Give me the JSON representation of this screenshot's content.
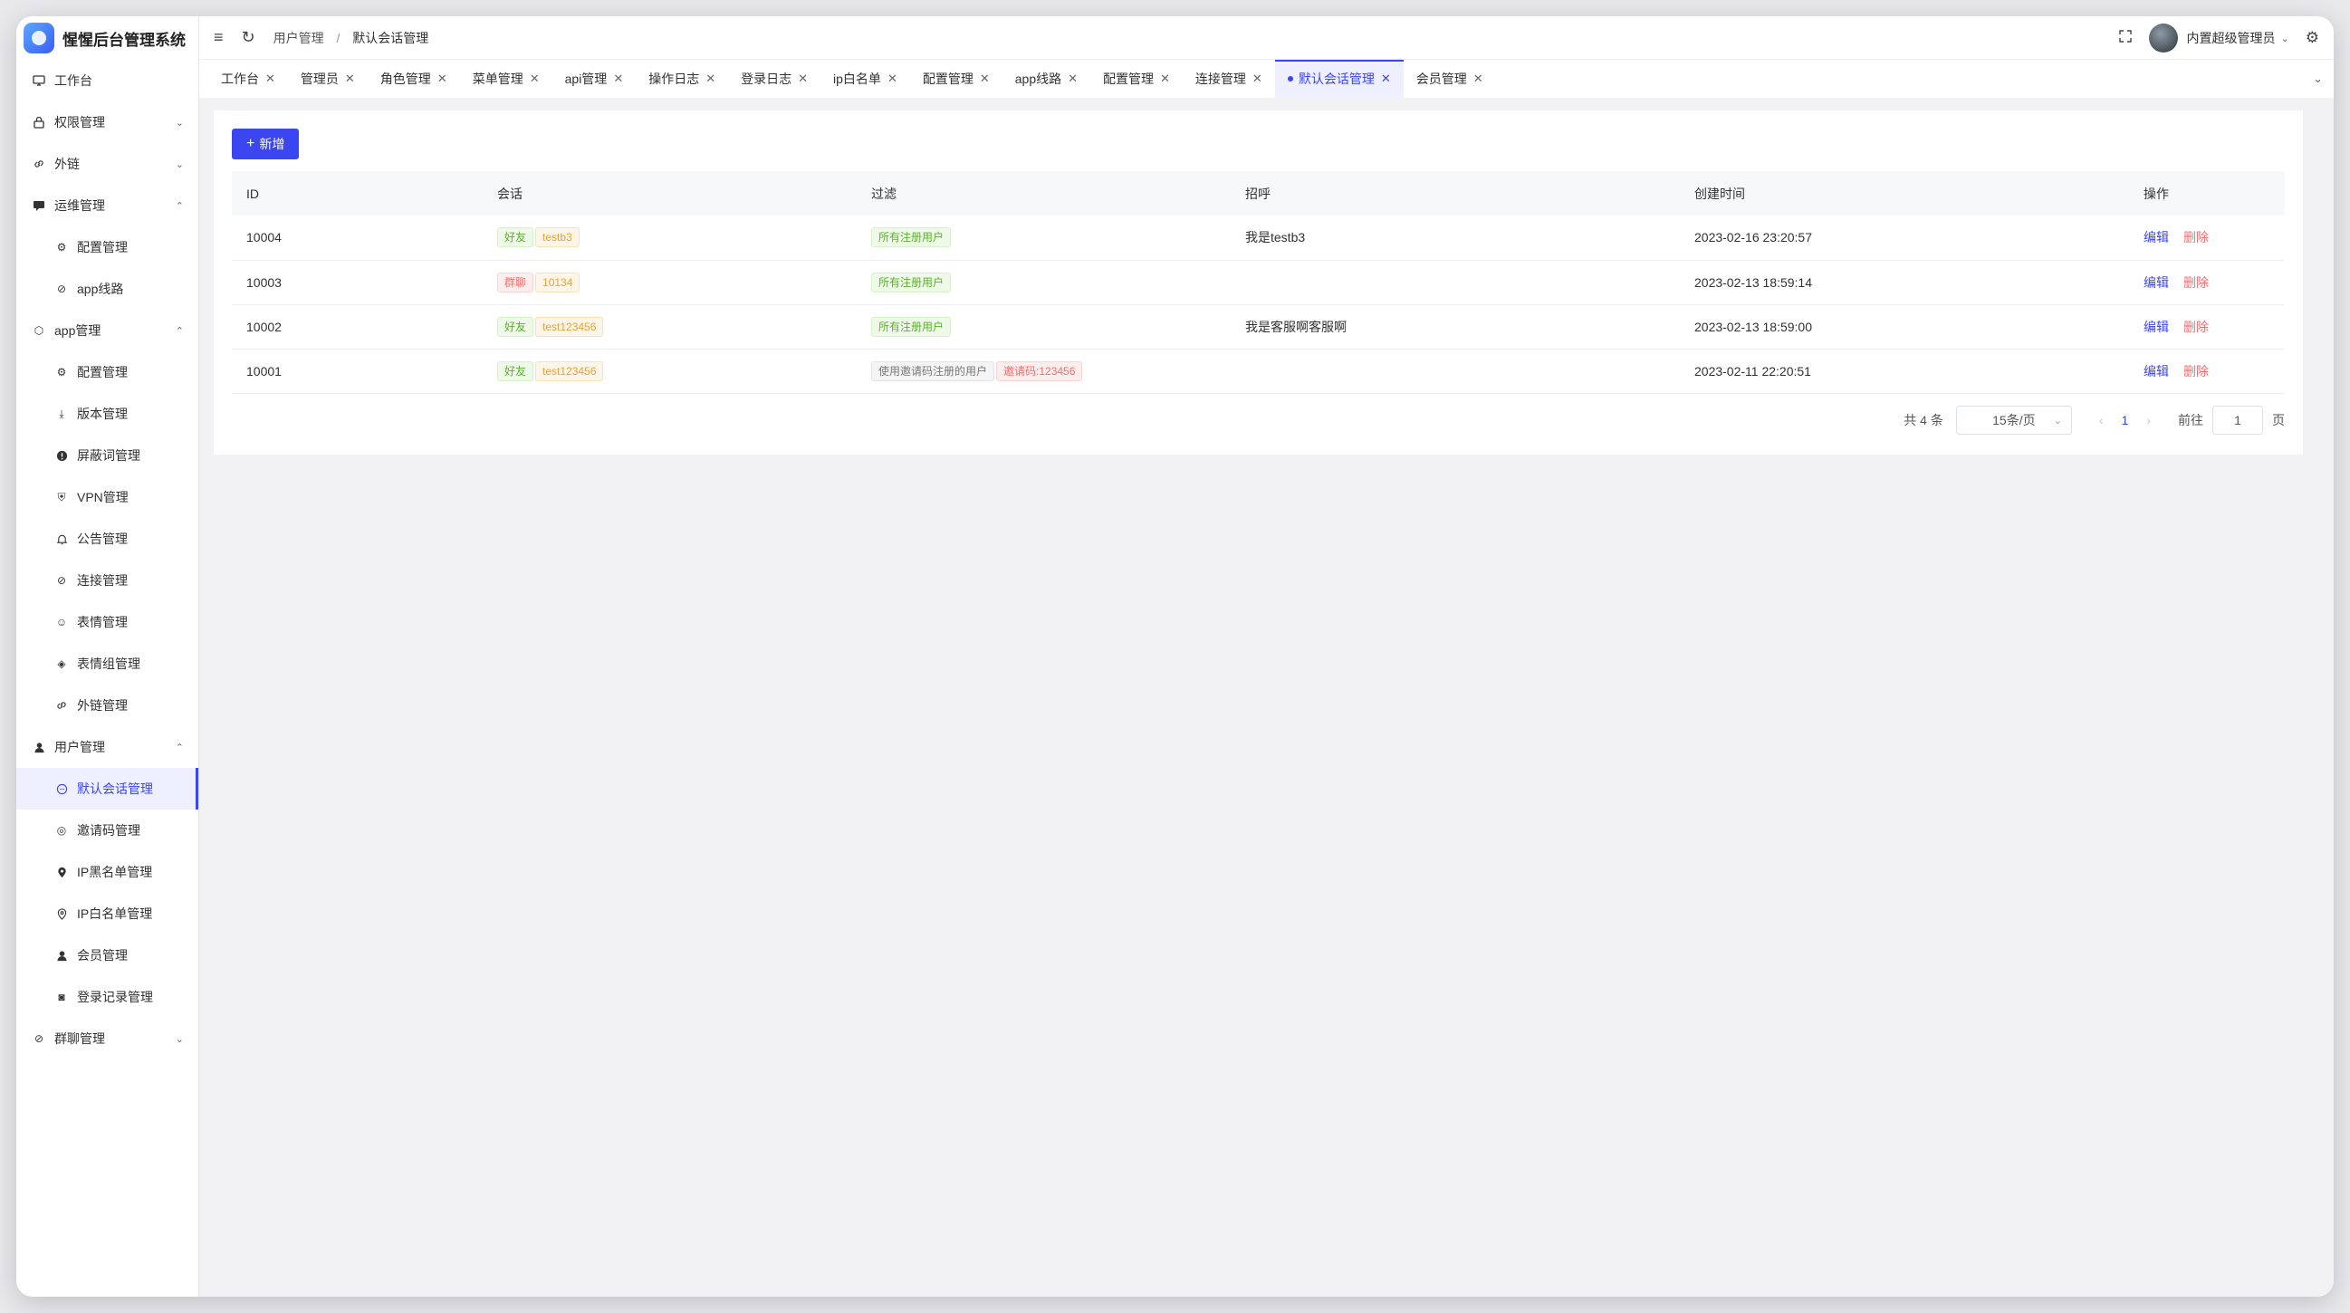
{
  "app": {
    "title": "惺惺后台管理系统"
  },
  "sidebar": {
    "items": [
      {
        "label": "工作台",
        "icon": "monitor-icon"
      },
      {
        "label": "权限管理",
        "icon": "lock-icon",
        "expanded": false
      },
      {
        "label": "外链",
        "icon": "link-icon",
        "expanded": false
      },
      {
        "label": "运维管理",
        "icon": "chat-icon",
        "expanded": true
      },
      {
        "label": "配置管理",
        "icon": "gear-icon"
      },
      {
        "label": "app线路",
        "icon": "connection-icon"
      },
      {
        "label": "app管理",
        "icon": "app-icon",
        "expanded": true
      },
      {
        "label": "配置管理",
        "icon": "gear-icon"
      },
      {
        "label": "版本管理",
        "icon": "download-icon"
      },
      {
        "label": "屏蔽词管理",
        "icon": "warning-icon"
      },
      {
        "label": "VPN管理",
        "icon": "vpn-icon"
      },
      {
        "label": "公告管理",
        "icon": "bell-icon"
      },
      {
        "label": "连接管理",
        "icon": "connection-icon"
      },
      {
        "label": "表情管理",
        "icon": "smile-icon"
      },
      {
        "label": "表情组管理",
        "icon": "layers-icon"
      },
      {
        "label": "外链管理",
        "icon": "link-icon"
      },
      {
        "label": "用户管理",
        "icon": "user-icon",
        "expanded": true
      },
      {
        "label": "默认会话管理",
        "icon": "chat-bubble-icon",
        "active": true
      },
      {
        "label": "邀请码管理",
        "icon": "code-icon"
      },
      {
        "label": "IP黑名单管理",
        "icon": "location-icon"
      },
      {
        "label": "IP白名单管理",
        "icon": "location-outline-icon"
      },
      {
        "label": "会员管理",
        "icon": "user-icon"
      },
      {
        "label": "登录记录管理",
        "icon": "camera-icon"
      },
      {
        "label": "群聊管理",
        "icon": "group-icon",
        "expanded": false
      }
    ]
  },
  "header": {
    "breadcrumb": [
      "用户管理",
      "默认会话管理"
    ],
    "user_name": "内置超级管理员"
  },
  "tabs": [
    {
      "label": "工作台"
    },
    {
      "label": "管理员"
    },
    {
      "label": "角色管理"
    },
    {
      "label": "菜单管理"
    },
    {
      "label": "api管理"
    },
    {
      "label": "操作日志"
    },
    {
      "label": "登录日志"
    },
    {
      "label": "ip白名单"
    },
    {
      "label": "配置管理"
    },
    {
      "label": "app线路"
    },
    {
      "label": "配置管理"
    },
    {
      "label": "连接管理"
    },
    {
      "label": "默认会话管理",
      "active": true
    },
    {
      "label": "会员管理"
    }
  ],
  "toolbar": {
    "add_label": "新增"
  },
  "table": {
    "columns": [
      "ID",
      "会话",
      "过滤",
      "招呼",
      "创建时间",
      "操作"
    ],
    "rows": [
      {
        "id": "10004",
        "session_type": "好友",
        "session_type_color": "green",
        "session_target": "testb3",
        "filter": "所有注册用户",
        "filter_extra": "",
        "greeting": "我是testb3",
        "created": "2023-02-16 23:20:57"
      },
      {
        "id": "10003",
        "session_type": "群聊",
        "session_type_color": "red",
        "session_target": "10134",
        "filter": "所有注册用户",
        "filter_extra": "",
        "greeting": "",
        "created": "2023-02-13 18:59:14"
      },
      {
        "id": "10002",
        "session_type": "好友",
        "session_type_color": "green",
        "session_target": "test123456",
        "filter": "所有注册用户",
        "filter_extra": "",
        "greeting": "我是客服啊客服啊",
        "created": "2023-02-13 18:59:00"
      },
      {
        "id": "10001",
        "session_type": "好友",
        "session_type_color": "green",
        "session_target": "test123456",
        "filter": "使用邀请码注册的用户",
        "filter_extra": "邀请码:123456",
        "greeting": "",
        "created": "2023-02-11 22:20:51"
      }
    ],
    "actions": {
      "edit": "编辑",
      "delete": "删除"
    }
  },
  "pagination": {
    "total_text": "共 4 条",
    "page_size": "15条/页",
    "current_page": "1",
    "goto_label": "前往",
    "goto_value": "1",
    "page_suffix": "页"
  },
  "colors": {
    "accent": "#3b45f0",
    "danger": "#f56c6c"
  }
}
